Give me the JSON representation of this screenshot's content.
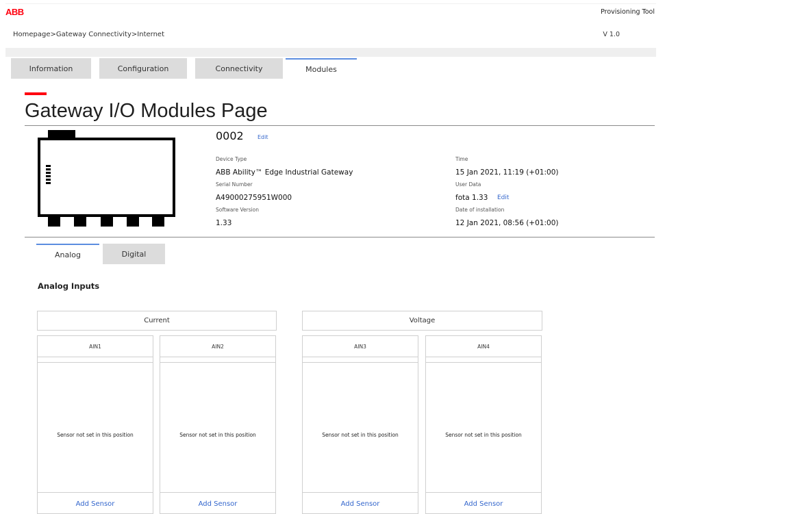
{
  "header": {
    "logo": "ABB",
    "app_title": "Provisioning Tool",
    "breadcrumb": "Homepage>Gateway Connectivity>Internet",
    "version": "V 1.0"
  },
  "tabs": [
    {
      "label": "Information",
      "active": false
    },
    {
      "label": "Configuration",
      "active": false
    },
    {
      "label": "Connectivity",
      "active": false
    },
    {
      "label": "Modules",
      "active": true
    }
  ],
  "page": {
    "title": "Gateway I/O Modules Page"
  },
  "device": {
    "id": "0002",
    "edit_label": "Edit",
    "device_type_label": "Device Type",
    "device_type": "ABB Ability™ Edge Industrial Gateway",
    "serial_label": "Serial Number",
    "serial": "A49000275951W000",
    "software_label": "Software Version",
    "software": "1.33",
    "time_label": "Time",
    "time": "15 Jan 2021, 11:19 (+01:00)",
    "user_data_label": "User Data",
    "user_data": "fota 1.33",
    "user_data_edit": "Edit",
    "install_label": "Date of installation",
    "install": "12 Jan 2021, 08:56 (+01:00)"
  },
  "subtabs": [
    {
      "label": "Analog",
      "active": true
    },
    {
      "label": "Digital",
      "active": false
    }
  ],
  "analog": {
    "title": "Analog Inputs",
    "groups": [
      "Current",
      "Voltage"
    ],
    "inputs": [
      {
        "name": "AIN1",
        "message": "Sensor not set in this position",
        "action": "Add Sensor"
      },
      {
        "name": "AIN2",
        "message": "Sensor not set in this position",
        "action": "Add Sensor"
      },
      {
        "name": "AIN3",
        "message": "Sensor not set in this position",
        "action": "Add Sensor"
      },
      {
        "name": "AIN4",
        "message": "Sensor not set in this position",
        "action": "Add Sensor"
      }
    ]
  },
  "colors": {
    "brand_red": "#ff000f",
    "link_blue": "#3366cc",
    "tab_accent": "#5b8de0"
  }
}
